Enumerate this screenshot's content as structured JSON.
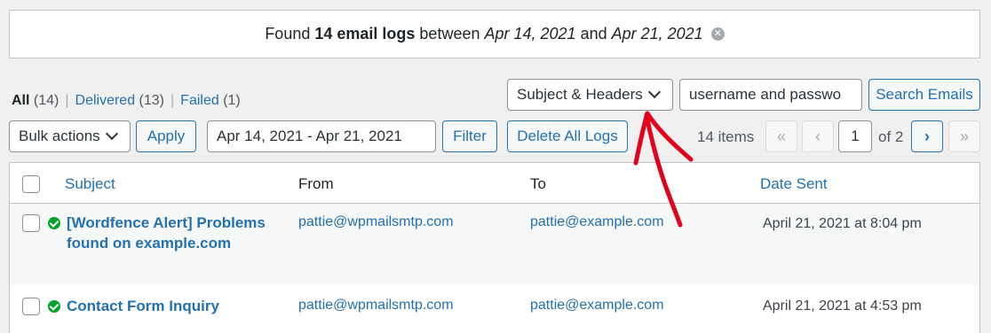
{
  "notice": {
    "prefix": "Found ",
    "count": "14 email logs",
    "between": " between ",
    "date_from": "Apr 14, 2021",
    "and": " and ",
    "date_to": "Apr 21, 2021"
  },
  "views": {
    "all_label": "All",
    "all_count": " (14)",
    "delivered_label": "Delivered",
    "delivered_count": " (13)",
    "failed_label": "Failed",
    "failed_count": " (1)"
  },
  "search": {
    "field_select": "Subject & Headers",
    "query": "username and passwo",
    "button": "Search Emails"
  },
  "toolbar": {
    "bulk_select": "Bulk actions",
    "apply": "Apply",
    "date_range": "Apr 14, 2021 - Apr 21, 2021",
    "filter": "Filter",
    "delete_all": "Delete All Logs"
  },
  "pagination": {
    "items": "14 items",
    "first": "«",
    "prev": "‹",
    "current_page": "1",
    "of_total": "of 2",
    "next": "›",
    "last": "»"
  },
  "table": {
    "headers": {
      "subject": "Subject",
      "from": "From",
      "to": "To",
      "date": "Date Sent"
    },
    "rows": [
      {
        "subject_line1": "[Wordfence Alert] Problems",
        "subject_line2": "found on example.com",
        "status_icon": "check-circle-icon",
        "from": "pattie@wpmailsmtp.com",
        "to": "pattie@example.com",
        "date": "April 21, 2021 at 8:04 pm"
      },
      {
        "subject_line1": "Contact Form Inquiry",
        "subject_line2": "",
        "status_icon": "check-circle-icon",
        "from": "pattie@wpmailsmtp.com",
        "to": "pattie@example.com",
        "date": "April 21, 2021 at 4:53 pm"
      }
    ]
  },
  "colors": {
    "link": "#2271b1",
    "success": "#00a32a",
    "annotation_arrow": "#e2001a"
  }
}
